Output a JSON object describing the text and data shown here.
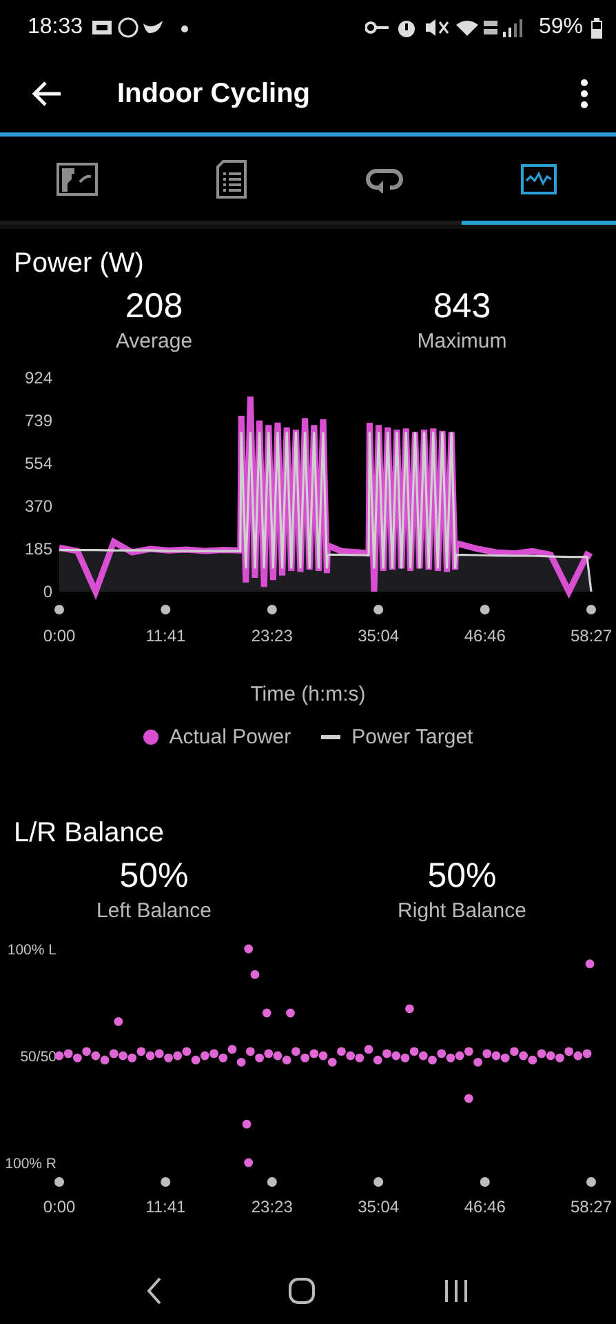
{
  "status_bar": {
    "time": "18:33",
    "battery": "59%"
  },
  "app_bar": {
    "title": "Indoor Cycling"
  },
  "tabs": [
    {
      "kind": "map",
      "selected": false
    },
    {
      "kind": "details",
      "selected": false
    },
    {
      "kind": "laps",
      "selected": false
    },
    {
      "kind": "charts",
      "selected": true
    }
  ],
  "power": {
    "title": "Power (W)",
    "stats": [
      {
        "value": "208",
        "label": "Average"
      },
      {
        "value": "843",
        "label": "Maximum"
      }
    ],
    "chart_data": {
      "type": "line",
      "xlabel": "Time (h:m:s)",
      "x": [
        0,
        2,
        4,
        6,
        8,
        10,
        12,
        14,
        16,
        18,
        19.9,
        20,
        20.5,
        21,
        21.5,
        22,
        22.5,
        23,
        23.5,
        24,
        24.5,
        25,
        25.5,
        26,
        26.5,
        27,
        27.5,
        28,
        28.5,
        29,
        29.4,
        29.5,
        31,
        33,
        34,
        34.1,
        34.6,
        35.1,
        35.6,
        36.1,
        36.6,
        37.1,
        37.6,
        38.1,
        38.6,
        39.1,
        39.6,
        40.1,
        40.6,
        41.1,
        41.6,
        42.1,
        42.6,
        43.1,
        43.5,
        43.6,
        46,
        48,
        50,
        52,
        54,
        56,
        58,
        58.45
      ],
      "series": [
        {
          "name": "Actual Power",
          "color": "#d94fd2",
          "values": [
            190,
            175,
            0,
            215,
            170,
            185,
            178,
            182,
            176,
            180,
            178,
            760,
            40,
            843,
            60,
            740,
            20,
            720,
            50,
            730,
            70,
            710,
            90,
            700,
            85,
            750,
            95,
            720,
            90,
            745,
            80,
            200,
            175,
            170,
            165,
            730,
            0,
            720,
            90,
            710,
            95,
            700,
            100,
            705,
            90,
            690,
            100,
            700,
            95,
            705,
            90,
            695,
            85,
            690,
            95,
            210,
            185,
            170,
            165,
            175,
            160,
            0,
            160,
            150
          ]
        },
        {
          "name": "Power Target",
          "color": "#d0d0d0",
          "values": [
            180,
            180,
            180,
            178,
            178,
            178,
            176,
            176,
            175,
            175,
            175,
            690,
            100,
            690,
            100,
            690,
            100,
            690,
            100,
            690,
            100,
            690,
            100,
            690,
            100,
            690,
            100,
            690,
            100,
            690,
            100,
            160,
            160,
            158,
            158,
            690,
            100,
            690,
            100,
            690,
            100,
            690,
            100,
            690,
            100,
            690,
            100,
            690,
            100,
            690,
            100,
            690,
            100,
            690,
            100,
            160,
            158,
            156,
            155,
            155,
            152,
            150,
            150,
            0
          ]
        }
      ],
      "xlim": [
        0,
        58.45
      ],
      "ylim": [
        0,
        924
      ],
      "xticks": [
        {
          "value": 0,
          "label": "0:00"
        },
        {
          "value": 11.68,
          "label": "11:41"
        },
        {
          "value": 23.38,
          "label": "23:23"
        },
        {
          "value": 35.07,
          "label": "35:04"
        },
        {
          "value": 46.77,
          "label": "46:46"
        },
        {
          "value": 58.45,
          "label": "58:27"
        }
      ],
      "yticks": [
        0,
        185,
        370,
        554,
        739,
        924
      ]
    }
  },
  "balance": {
    "title": "L/R Balance",
    "stats": [
      {
        "value": "50%",
        "label": "Left Balance"
      },
      {
        "value": "50%",
        "label": "Right Balance"
      }
    ],
    "chart_data": {
      "type": "scatter",
      "x": [
        0,
        1,
        2,
        3,
        4,
        5,
        6,
        7,
        8,
        9,
        10,
        11,
        12,
        13,
        14,
        15,
        16,
        17,
        18,
        19,
        20,
        21,
        22,
        23,
        24,
        25,
        26,
        27,
        28,
        29,
        30,
        31,
        32,
        33,
        34,
        35,
        36,
        37,
        38,
        39,
        40,
        41,
        42,
        43,
        44,
        45,
        46,
        47,
        48,
        49,
        50,
        51,
        52,
        53,
        54,
        55,
        56,
        57,
        58,
        6.5,
        20.8,
        21.5,
        22.8,
        20.6,
        20.8,
        25.4,
        38.5,
        45,
        58.3
      ],
      "series": [
        {
          "color": "#e066d6",
          "values": [
            0,
            2,
            -2,
            4,
            0,
            -4,
            2,
            0,
            -2,
            4,
            0,
            2,
            -2,
            0,
            4,
            -4,
            0,
            2,
            -2,
            6,
            -6,
            4,
            -2,
            2,
            0,
            -4,
            4,
            -2,
            2,
            0,
            -6,
            4,
            0,
            -2,
            6,
            -4,
            2,
            0,
            -2,
            4,
            0,
            -4,
            2,
            -2,
            0,
            4,
            -6,
            2,
            0,
            -2,
            4,
            0,
            -4,
            2,
            0,
            -2,
            4,
            0,
            2,
            32,
            100,
            76,
            40,
            -64,
            -100,
            40,
            44,
            -40,
            86
          ]
        }
      ],
      "xlim": [
        0,
        58.45
      ],
      "ylim": [
        -100,
        100
      ],
      "xticks": [
        {
          "value": 0,
          "label": "0:00"
        },
        {
          "value": 11.68,
          "label": "11:41"
        },
        {
          "value": 23.38,
          "label": "23:23"
        },
        {
          "value": 35.07,
          "label": "35:04"
        },
        {
          "value": 46.77,
          "label": "46:46"
        },
        {
          "value": 58.45,
          "label": "58:27"
        }
      ],
      "yticks": [
        {
          "value": -100,
          "label": "100% R"
        },
        {
          "value": 0,
          "label": "50/50"
        },
        {
          "value": 100,
          "label": "100% L"
        }
      ]
    }
  }
}
